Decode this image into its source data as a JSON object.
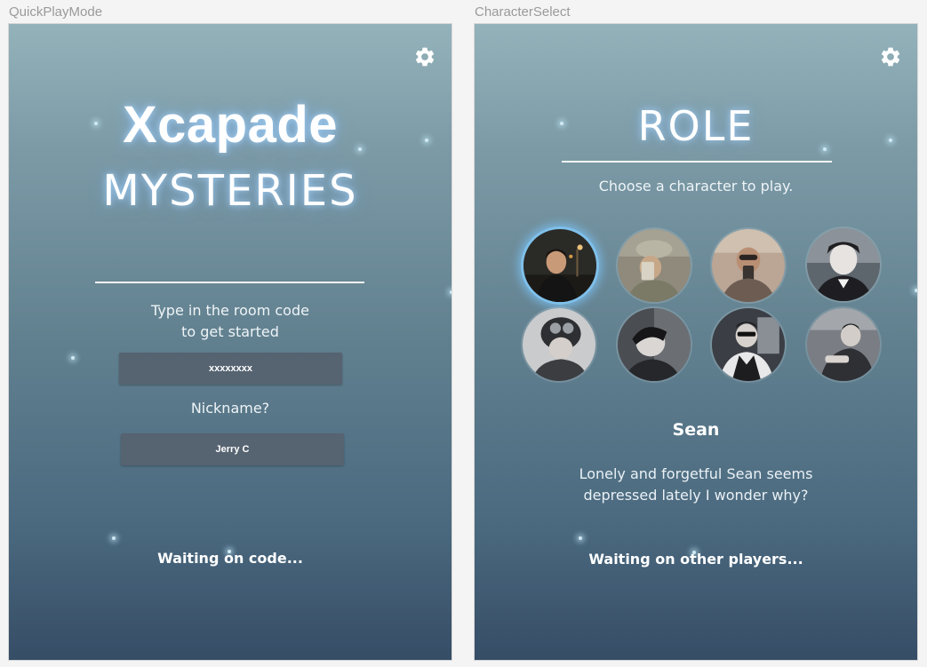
{
  "artboards": {
    "quickplay_label": "QuickPlayMode",
    "character_label": "CharacterSelect"
  },
  "quickplay": {
    "title_line1": "Xcapade",
    "title_line2": "MYSTERIES",
    "room_code_prompt_line1": "Type in the room code",
    "room_code_prompt_line2": "to get started",
    "room_code_value": "xxxxxxxx",
    "nickname_prompt": "Nickname?",
    "nickname_value": "Jerry C",
    "status": "Waiting on code..."
  },
  "character_select": {
    "title": "ROLE",
    "subtitle": "Choose a character to play.",
    "characters": [
      {
        "id": "sean",
        "selected": true
      },
      {
        "id": "char-2",
        "selected": false
      },
      {
        "id": "char-3",
        "selected": false
      },
      {
        "id": "char-4",
        "selected": false
      },
      {
        "id": "char-5",
        "selected": false
      },
      {
        "id": "char-6",
        "selected": false
      },
      {
        "id": "char-7",
        "selected": false
      },
      {
        "id": "char-8",
        "selected": false
      }
    ],
    "selected_name": "Sean",
    "description_line1": "Lonely and forgetful Sean seems",
    "description_line2": "depressed lately I wonder why?",
    "status": "Waiting on other players..."
  },
  "icons": {
    "settings": "gear-icon"
  },
  "colors": {
    "accent_glow": "#7fc0ea",
    "field_bg": "#566371",
    "text": "#ffffff"
  }
}
